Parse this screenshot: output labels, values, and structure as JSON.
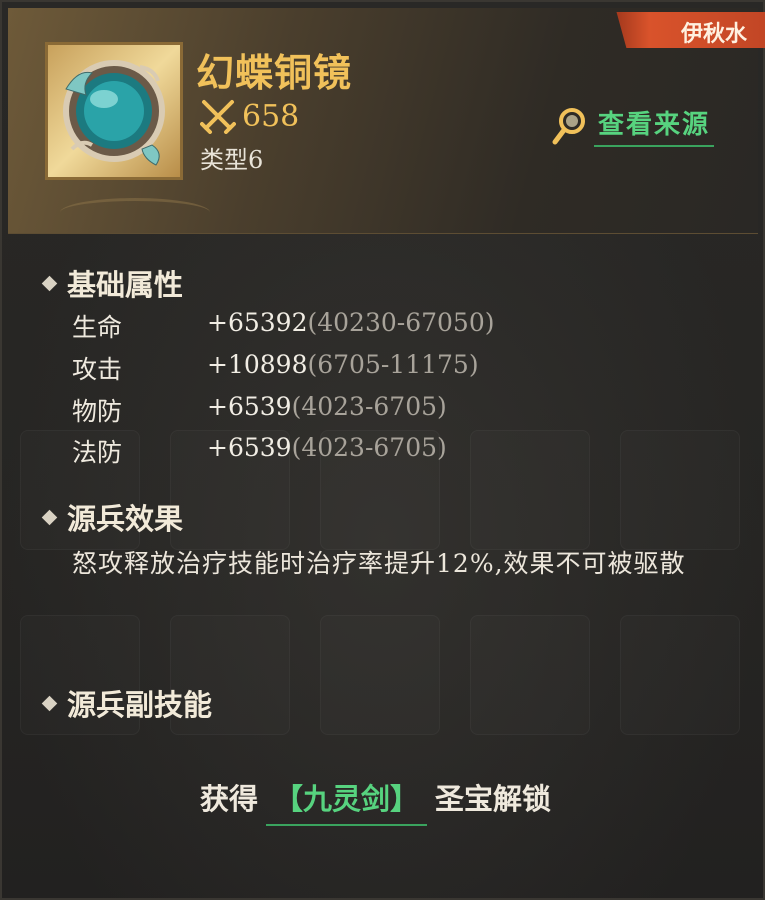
{
  "item": {
    "name": "幻蝶铜镜",
    "power": "658",
    "type_label": "类型6",
    "source_label": "查看来源",
    "owner": "伊秋水"
  },
  "sections": {
    "base_title": "基础属性",
    "effect_title": "源兵效果",
    "subskill_title": "源兵副技能"
  },
  "attributes": [
    {
      "name": "生命",
      "value": "+65392",
      "range": "(40230-67050)"
    },
    {
      "name": "攻击",
      "value": "+10898",
      "range": "(6705-11175)"
    },
    {
      "name": "物防",
      "value": "+6539",
      "range": "(4023-6705)"
    },
    {
      "name": "法防",
      "value": "+6539",
      "range": "(4023-6705)"
    }
  ],
  "effect_text": "怒攻释放治疗技能时治疗率提升12%,效果不可被驱散",
  "unlock": {
    "prefix": "获得",
    "item": "【九灵剑】",
    "suffix": "圣宝解锁"
  },
  "colors": {
    "accent_gold": "#f1c15a",
    "link_green": "#57d37f",
    "owner_tag": "#d9532b"
  },
  "icons": [
    "mirror-item-icon",
    "crossed-swords-icon",
    "magnifier-icon",
    "diamond-bullet-icon"
  ]
}
